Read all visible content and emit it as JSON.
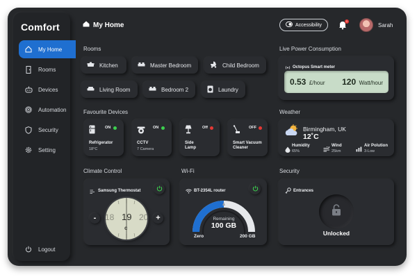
{
  "app": {
    "logo": "Comfort"
  },
  "sidebar": {
    "items": [
      {
        "label": "My Home",
        "icon": "home-icon",
        "active": true
      },
      {
        "label": "Rooms",
        "icon": "door-icon"
      },
      {
        "label": "Devices",
        "icon": "robot-icon"
      },
      {
        "label": "Automation",
        "icon": "fingerprint-icon"
      },
      {
        "label": "Security",
        "icon": "shield-icon"
      },
      {
        "label": "Setting",
        "icon": "gear-icon"
      }
    ],
    "logout": "Logout"
  },
  "header": {
    "title": "My Home",
    "accessibility": "Accessibility",
    "notification_count": "1",
    "user_name": "Sarah"
  },
  "rooms": {
    "label": "Rooms",
    "items": [
      "Kitchen",
      "Master Bedroom",
      "Child Bedroom",
      "Living Room",
      "Bedroom 2",
      "Laundry"
    ]
  },
  "power": {
    "label": "Live Power Consumption",
    "meter_name": "Octopus Smart meter",
    "cost_value": "0.53",
    "cost_unit": "£/hour",
    "watt_value": "120",
    "watt_unit": "Watt/hour"
  },
  "favourites": {
    "label": "Favourite Devices",
    "devices": [
      {
        "name": "Refrigerator",
        "sub": "18°C",
        "status": "ON",
        "status_color": "#3ccf4e"
      },
      {
        "name": "CCTV",
        "sub": "7 Camera",
        "status": "ON",
        "status_color": "#3ccf4e"
      },
      {
        "name": "Side Lamp",
        "sub": "",
        "status": "Off",
        "status_color": "#e53935"
      },
      {
        "name": "Smart Vacuum Cleaner",
        "sub": "",
        "status": "OFF",
        "status_color": "#e53935"
      }
    ]
  },
  "weather": {
    "label": "Weather",
    "location": "Birmingham, UK",
    "temperature": "12˚C",
    "humidity_label": "Humidity",
    "humidity_value": "65%",
    "wind_label": "Wind",
    "wind_value": "25km",
    "air_label": "Air Polution",
    "air_value": "3-Low"
  },
  "climate": {
    "label": "Climate Control",
    "device": "Samsung Thermostat",
    "minus": "-",
    "plus": "+",
    "temps": [
      "18",
      "19",
      "20"
    ],
    "unit": "c"
  },
  "wifi": {
    "label": "Wi-Fi",
    "device": "BT-2354L router",
    "remaining_label": "Remaining",
    "remaining_value": "100 GB",
    "min_label": "Zero",
    "max_label": "200 GB",
    "used_fraction": 0.5
  },
  "security": {
    "label": "Security",
    "entrances": "Entrances",
    "status": "Unlocked"
  },
  "colors": {
    "accent": "#1f6fd0",
    "on": "#3ccf4e",
    "off": "#e53935",
    "meter_bg": "#c8dcc8"
  }
}
